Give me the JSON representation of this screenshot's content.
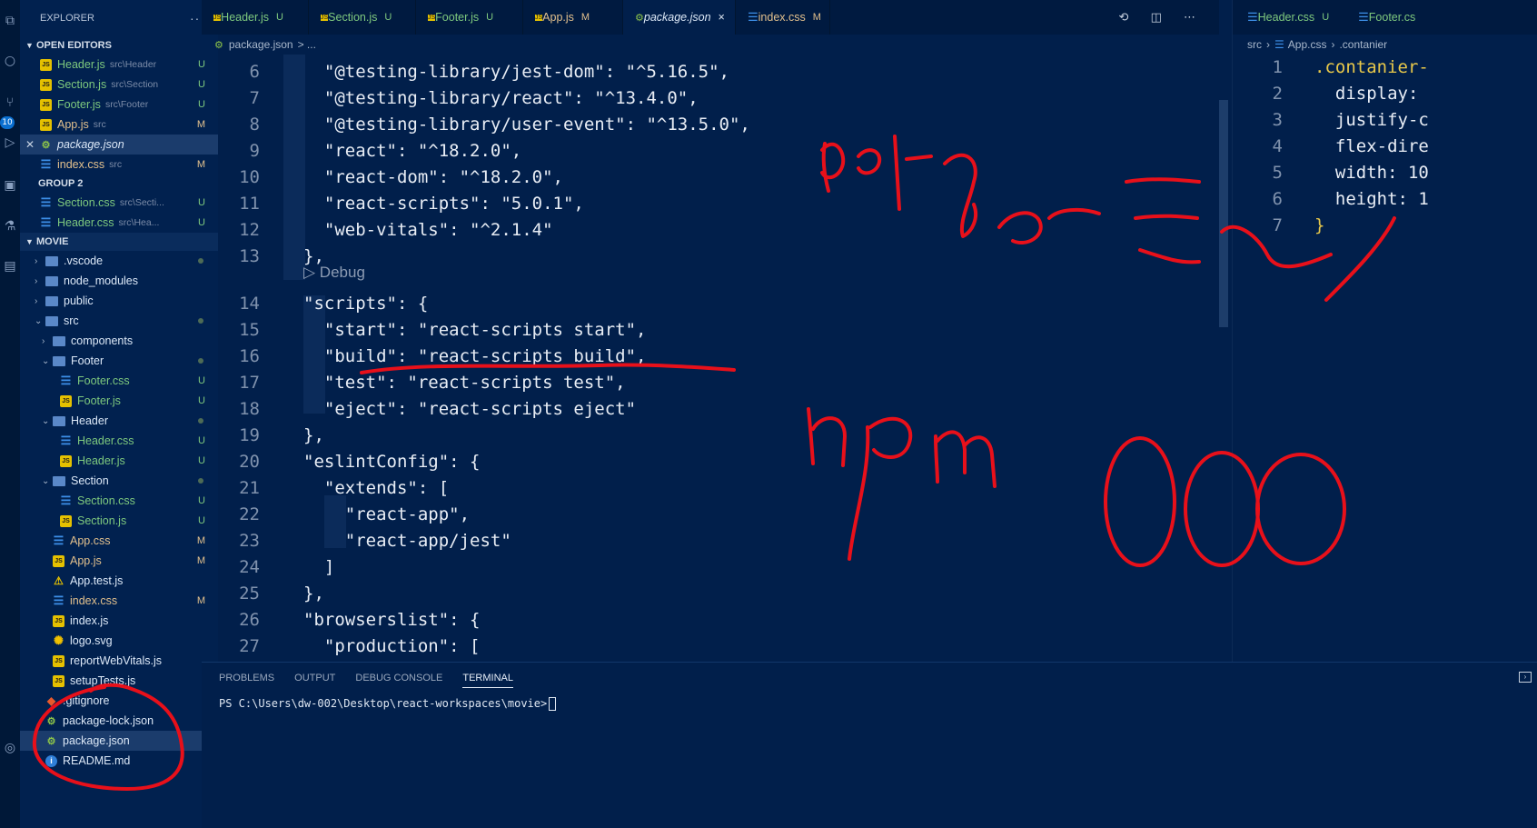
{
  "explorer": {
    "title": "EXPLORER",
    "more": "···",
    "open_editors_title": "OPEN EDITORS",
    "open_editors": [
      {
        "name": "Header.js",
        "path": "src\\Header",
        "status": "U",
        "type": "js"
      },
      {
        "name": "Section.js",
        "path": "src\\Section",
        "status": "U",
        "type": "js"
      },
      {
        "name": "Footer.js",
        "path": "src\\Footer",
        "status": "U",
        "type": "js"
      },
      {
        "name": "App.js",
        "path": "src",
        "status": "M",
        "type": "js"
      },
      {
        "name": "package.json",
        "path": "",
        "status": "",
        "type": "json"
      },
      {
        "name": "index.css",
        "path": "src",
        "status": "M",
        "type": "css"
      }
    ],
    "group2_title": "GROUP 2",
    "group2": [
      {
        "name": "Section.css",
        "path": "src\\Secti...",
        "status": "U",
        "type": "css"
      },
      {
        "name": "Header.css",
        "path": "src\\Hea...",
        "status": "U",
        "type": "css"
      }
    ],
    "project_title": "MOVIE",
    "tree": [
      {
        "name": ".vscode",
        "kind": "folder-closed",
        "depth": 0
      },
      {
        "name": "node_modules",
        "kind": "folder-closed",
        "depth": 0
      },
      {
        "name": "public",
        "kind": "folder-closed",
        "depth": 0
      },
      {
        "name": "src",
        "kind": "folder-open",
        "depth": 0
      },
      {
        "name": "components",
        "kind": "folder-closed",
        "depth": 1
      },
      {
        "name": "Footer",
        "kind": "folder-open",
        "depth": 1
      },
      {
        "name": "Footer.css",
        "kind": "css",
        "depth": 2,
        "status": "U"
      },
      {
        "name": "Footer.js",
        "kind": "js",
        "depth": 2,
        "status": "U"
      },
      {
        "name": "Header",
        "kind": "folder-open",
        "depth": 1
      },
      {
        "name": "Header.css",
        "kind": "css",
        "depth": 2,
        "status": "U"
      },
      {
        "name": "Header.js",
        "kind": "js",
        "depth": 2,
        "status": "U"
      },
      {
        "name": "Section",
        "kind": "folder-open",
        "depth": 1
      },
      {
        "name": "Section.css",
        "kind": "css",
        "depth": 2,
        "status": "U"
      },
      {
        "name": "Section.js",
        "kind": "js",
        "depth": 2,
        "status": "U"
      },
      {
        "name": "App.css",
        "kind": "css",
        "depth": 1,
        "status": "M"
      },
      {
        "name": "App.js",
        "kind": "js",
        "depth": 1,
        "status": "M"
      },
      {
        "name": "App.test.js",
        "kind": "test",
        "depth": 1
      },
      {
        "name": "index.css",
        "kind": "css",
        "depth": 1,
        "status": "M"
      },
      {
        "name": "index.js",
        "kind": "js",
        "depth": 1
      },
      {
        "name": "logo.svg",
        "kind": "svg",
        "depth": 1
      },
      {
        "name": "reportWebVitals.js",
        "kind": "js",
        "depth": 1
      },
      {
        "name": "setupTests.js",
        "kind": "js",
        "depth": 1
      },
      {
        "name": ".gitignore",
        "kind": "git",
        "depth": 0
      },
      {
        "name": "package-lock.json",
        "kind": "json",
        "depth": 0
      },
      {
        "name": "package.json",
        "kind": "json",
        "depth": 0,
        "selected": true
      },
      {
        "name": "README.md",
        "kind": "info",
        "depth": 0
      }
    ]
  },
  "tabs": [
    {
      "label": "Header.js",
      "status": "U",
      "type": "js"
    },
    {
      "label": "Section.js",
      "status": "U",
      "type": "js"
    },
    {
      "label": "Footer.js",
      "status": "U",
      "type": "js"
    },
    {
      "label": "App.js",
      "status": "M",
      "type": "js"
    },
    {
      "label": "package.json",
      "status": "×",
      "type": "json",
      "active": true
    },
    {
      "label": "index.css",
      "status": "M",
      "type": "css"
    }
  ],
  "breadcrumb": {
    "file": "package.json",
    "rest": "> ..."
  },
  "editor_lines": [
    {
      "n": "6",
      "code": "  \"@testing-library/jest-dom\": \"^5.16.5\","
    },
    {
      "n": "7",
      "code": "  \"@testing-library/react\": \"^13.4.0\","
    },
    {
      "n": "8",
      "code": "  \"@testing-library/user-event\": \"^13.5.0\","
    },
    {
      "n": "9",
      "code": "  \"react\": \"^18.2.0\","
    },
    {
      "n": "10",
      "code": "  \"react-dom\": \"^18.2.0\","
    },
    {
      "n": "11",
      "code": "  \"react-scripts\": \"5.0.1\","
    },
    {
      "n": "12",
      "code": "  \"web-vitals\": \"^2.1.4\""
    },
    {
      "n": "13",
      "code": "},"
    },
    {
      "n": "14",
      "code": "\"scripts\": {"
    },
    {
      "n": "15",
      "code": "  \"start\": \"react-scripts start\","
    },
    {
      "n": "16",
      "code": "  \"build\": \"react-scripts build\","
    },
    {
      "n": "17",
      "code": "  \"test\": \"react-scripts test\","
    },
    {
      "n": "18",
      "code": "  \"eject\": \"react-scripts eject\""
    },
    {
      "n": "19",
      "code": "},"
    },
    {
      "n": "20",
      "code": "\"eslintConfig\": {"
    },
    {
      "n": "21",
      "code": "  \"extends\": ["
    },
    {
      "n": "22",
      "code": "    \"react-app\","
    },
    {
      "n": "23",
      "code": "    \"react-app/jest\""
    },
    {
      "n": "24",
      "code": "  ]"
    },
    {
      "n": "25",
      "code": "},"
    },
    {
      "n": "26",
      "code": "\"browserslist\": {"
    },
    {
      "n": "27",
      "code": "  \"production\": ["
    }
  ],
  "codelens": "▷ Debug",
  "right_pane": {
    "tabs": [
      {
        "label": "Header.css",
        "status": "U"
      },
      {
        "label": "Footer.cs",
        "status": ""
      }
    ],
    "breadcrumb": {
      "folder": "src",
      "file": "App.css",
      "symbol": ".contanier"
    },
    "lines": [
      {
        "n": "1",
        "code": ".contanier-"
      },
      {
        "n": "2",
        "code": "  display:"
      },
      {
        "n": "3",
        "code": "  justify-c"
      },
      {
        "n": "4",
        "code": "  flex-dire"
      },
      {
        "n": "5",
        "code": "  width: 10"
      },
      {
        "n": "6",
        "code": "  height: 1"
      },
      {
        "n": "7",
        "code": "}"
      }
    ]
  },
  "panel": {
    "tabs": [
      "PROBLEMS",
      "OUTPUT",
      "DEBUG CONSOLE",
      "TERMINAL"
    ],
    "active_tab": "TERMINAL",
    "prompt": "PS C:\\Users\\dw-002\\Desktop\\react-workspaces\\movie>"
  },
  "badge_count": "10",
  "colors": {
    "accent": "#0a6fd0",
    "background": "#011f4b",
    "annotation": "#e8101a"
  }
}
